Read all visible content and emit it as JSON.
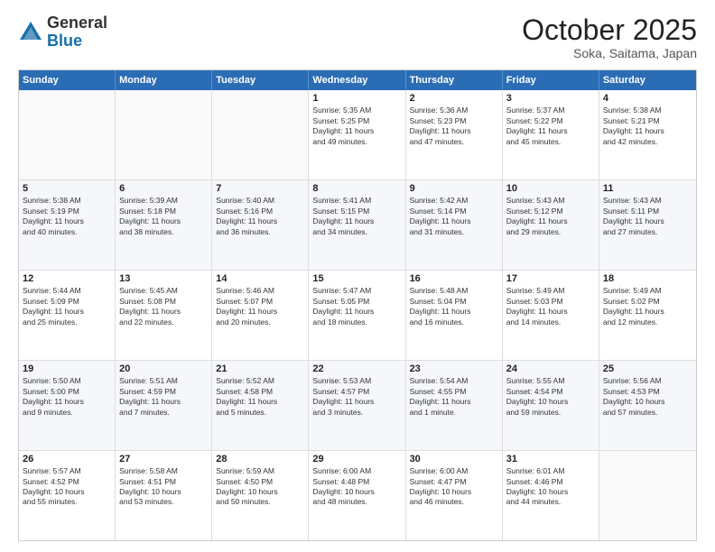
{
  "header": {
    "logo_general": "General",
    "logo_blue": "Blue",
    "month": "October 2025",
    "location": "Soka, Saitama, Japan"
  },
  "days_of_week": [
    "Sunday",
    "Monday",
    "Tuesday",
    "Wednesday",
    "Thursday",
    "Friday",
    "Saturday"
  ],
  "rows": [
    {
      "alt": false,
      "cells": [
        {
          "day": "",
          "lines": []
        },
        {
          "day": "",
          "lines": []
        },
        {
          "day": "",
          "lines": []
        },
        {
          "day": "1",
          "lines": [
            "Sunrise: 5:35 AM",
            "Sunset: 5:25 PM",
            "Daylight: 11 hours",
            "and 49 minutes."
          ]
        },
        {
          "day": "2",
          "lines": [
            "Sunrise: 5:36 AM",
            "Sunset: 5:23 PM",
            "Daylight: 11 hours",
            "and 47 minutes."
          ]
        },
        {
          "day": "3",
          "lines": [
            "Sunrise: 5:37 AM",
            "Sunset: 5:22 PM",
            "Daylight: 11 hours",
            "and 45 minutes."
          ]
        },
        {
          "day": "4",
          "lines": [
            "Sunrise: 5:38 AM",
            "Sunset: 5:21 PM",
            "Daylight: 11 hours",
            "and 42 minutes."
          ]
        }
      ]
    },
    {
      "alt": true,
      "cells": [
        {
          "day": "5",
          "lines": [
            "Sunrise: 5:38 AM",
            "Sunset: 5:19 PM",
            "Daylight: 11 hours",
            "and 40 minutes."
          ]
        },
        {
          "day": "6",
          "lines": [
            "Sunrise: 5:39 AM",
            "Sunset: 5:18 PM",
            "Daylight: 11 hours",
            "and 38 minutes."
          ]
        },
        {
          "day": "7",
          "lines": [
            "Sunrise: 5:40 AM",
            "Sunset: 5:16 PM",
            "Daylight: 11 hours",
            "and 36 minutes."
          ]
        },
        {
          "day": "8",
          "lines": [
            "Sunrise: 5:41 AM",
            "Sunset: 5:15 PM",
            "Daylight: 11 hours",
            "and 34 minutes."
          ]
        },
        {
          "day": "9",
          "lines": [
            "Sunrise: 5:42 AM",
            "Sunset: 5:14 PM",
            "Daylight: 11 hours",
            "and 31 minutes."
          ]
        },
        {
          "day": "10",
          "lines": [
            "Sunrise: 5:43 AM",
            "Sunset: 5:12 PM",
            "Daylight: 11 hours",
            "and 29 minutes."
          ]
        },
        {
          "day": "11",
          "lines": [
            "Sunrise: 5:43 AM",
            "Sunset: 5:11 PM",
            "Daylight: 11 hours",
            "and 27 minutes."
          ]
        }
      ]
    },
    {
      "alt": false,
      "cells": [
        {
          "day": "12",
          "lines": [
            "Sunrise: 5:44 AM",
            "Sunset: 5:09 PM",
            "Daylight: 11 hours",
            "and 25 minutes."
          ]
        },
        {
          "day": "13",
          "lines": [
            "Sunrise: 5:45 AM",
            "Sunset: 5:08 PM",
            "Daylight: 11 hours",
            "and 22 minutes."
          ]
        },
        {
          "day": "14",
          "lines": [
            "Sunrise: 5:46 AM",
            "Sunset: 5:07 PM",
            "Daylight: 11 hours",
            "and 20 minutes."
          ]
        },
        {
          "day": "15",
          "lines": [
            "Sunrise: 5:47 AM",
            "Sunset: 5:05 PM",
            "Daylight: 11 hours",
            "and 18 minutes."
          ]
        },
        {
          "day": "16",
          "lines": [
            "Sunrise: 5:48 AM",
            "Sunset: 5:04 PM",
            "Daylight: 11 hours",
            "and 16 minutes."
          ]
        },
        {
          "day": "17",
          "lines": [
            "Sunrise: 5:49 AM",
            "Sunset: 5:03 PM",
            "Daylight: 11 hours",
            "and 14 minutes."
          ]
        },
        {
          "day": "18",
          "lines": [
            "Sunrise: 5:49 AM",
            "Sunset: 5:02 PM",
            "Daylight: 11 hours",
            "and 12 minutes."
          ]
        }
      ]
    },
    {
      "alt": true,
      "cells": [
        {
          "day": "19",
          "lines": [
            "Sunrise: 5:50 AM",
            "Sunset: 5:00 PM",
            "Daylight: 11 hours",
            "and 9 minutes."
          ]
        },
        {
          "day": "20",
          "lines": [
            "Sunrise: 5:51 AM",
            "Sunset: 4:59 PM",
            "Daylight: 11 hours",
            "and 7 minutes."
          ]
        },
        {
          "day": "21",
          "lines": [
            "Sunrise: 5:52 AM",
            "Sunset: 4:58 PM",
            "Daylight: 11 hours",
            "and 5 minutes."
          ]
        },
        {
          "day": "22",
          "lines": [
            "Sunrise: 5:53 AM",
            "Sunset: 4:57 PM",
            "Daylight: 11 hours",
            "and 3 minutes."
          ]
        },
        {
          "day": "23",
          "lines": [
            "Sunrise: 5:54 AM",
            "Sunset: 4:55 PM",
            "Daylight: 11 hours",
            "and 1 minute."
          ]
        },
        {
          "day": "24",
          "lines": [
            "Sunrise: 5:55 AM",
            "Sunset: 4:54 PM",
            "Daylight: 10 hours",
            "and 59 minutes."
          ]
        },
        {
          "day": "25",
          "lines": [
            "Sunrise: 5:56 AM",
            "Sunset: 4:53 PM",
            "Daylight: 10 hours",
            "and 57 minutes."
          ]
        }
      ]
    },
    {
      "alt": false,
      "cells": [
        {
          "day": "26",
          "lines": [
            "Sunrise: 5:57 AM",
            "Sunset: 4:52 PM",
            "Daylight: 10 hours",
            "and 55 minutes."
          ]
        },
        {
          "day": "27",
          "lines": [
            "Sunrise: 5:58 AM",
            "Sunset: 4:51 PM",
            "Daylight: 10 hours",
            "and 53 minutes."
          ]
        },
        {
          "day": "28",
          "lines": [
            "Sunrise: 5:59 AM",
            "Sunset: 4:50 PM",
            "Daylight: 10 hours",
            "and 50 minutes."
          ]
        },
        {
          "day": "29",
          "lines": [
            "Sunrise: 6:00 AM",
            "Sunset: 4:48 PM",
            "Daylight: 10 hours",
            "and 48 minutes."
          ]
        },
        {
          "day": "30",
          "lines": [
            "Sunrise: 6:00 AM",
            "Sunset: 4:47 PM",
            "Daylight: 10 hours",
            "and 46 minutes."
          ]
        },
        {
          "day": "31",
          "lines": [
            "Sunrise: 6:01 AM",
            "Sunset: 4:46 PM",
            "Daylight: 10 hours",
            "and 44 minutes."
          ]
        },
        {
          "day": "",
          "lines": []
        }
      ]
    }
  ]
}
